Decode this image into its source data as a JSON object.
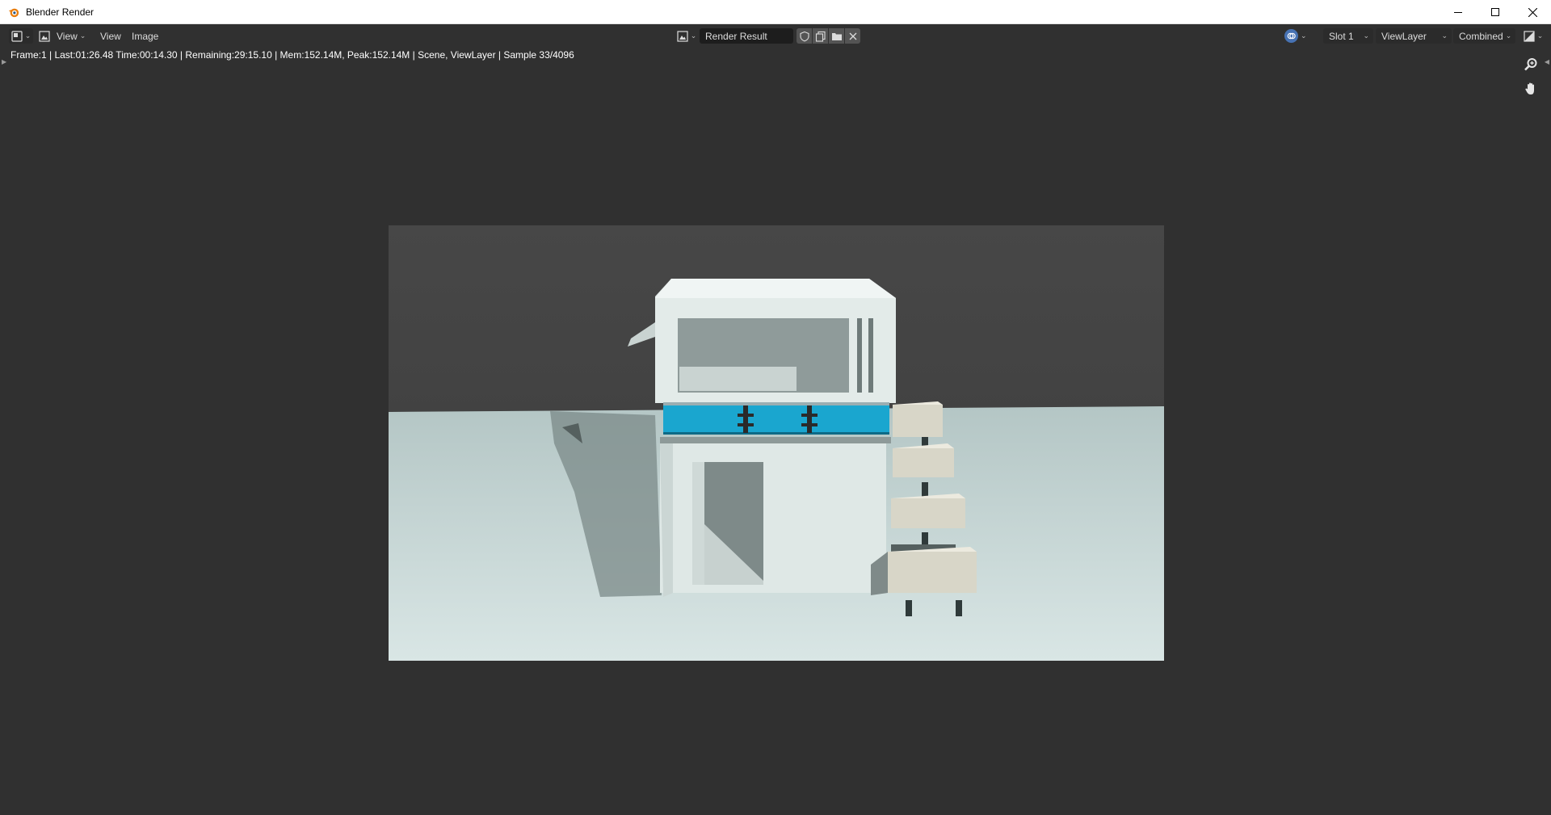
{
  "window": {
    "title": "Blender Render",
    "icons": {
      "app": "blender-logo-icon",
      "minimize": "minimize-icon",
      "maximize": "maximize-icon",
      "close": "close-icon"
    }
  },
  "header": {
    "editor_type_icon": "image-editor-icon",
    "view_mode_label": "View",
    "menus": {
      "view": "View",
      "image": "Image"
    },
    "image": {
      "name": "Render Result",
      "buttons": [
        "fake-user-icon",
        "duplicate-icon",
        "open-folder-icon",
        "close-icon"
      ]
    },
    "overlay_icon": "overlay-icon",
    "slot": "Slot 1",
    "view_layer": "ViewLayer",
    "pass": "Combined",
    "display_icon": "display-channels-icon"
  },
  "render_info": "Frame:1 | Last:01:26.48 Time:00:14.30 | Remaining:29:15.10 | Mem:152.14M, Peak:152.14M | Scene, ViewLayer | Sample 33/4096",
  "navigation": {
    "zoom_icon": "zoom-icon",
    "pan_icon": "hand-pan-icon"
  },
  "render": {
    "subject": "white two-storey building with blue railing and staircase",
    "colors": {
      "background": "#4a4a4a",
      "ground": "#cfdcdb",
      "walls": "#dfe8e6",
      "railing": "#1aa6cf",
      "stairs": "#d8d6c8"
    }
  },
  "colors": {
    "app_bg": "#303030",
    "accent": "#4772b3",
    "title_bar": "#ffffff"
  }
}
